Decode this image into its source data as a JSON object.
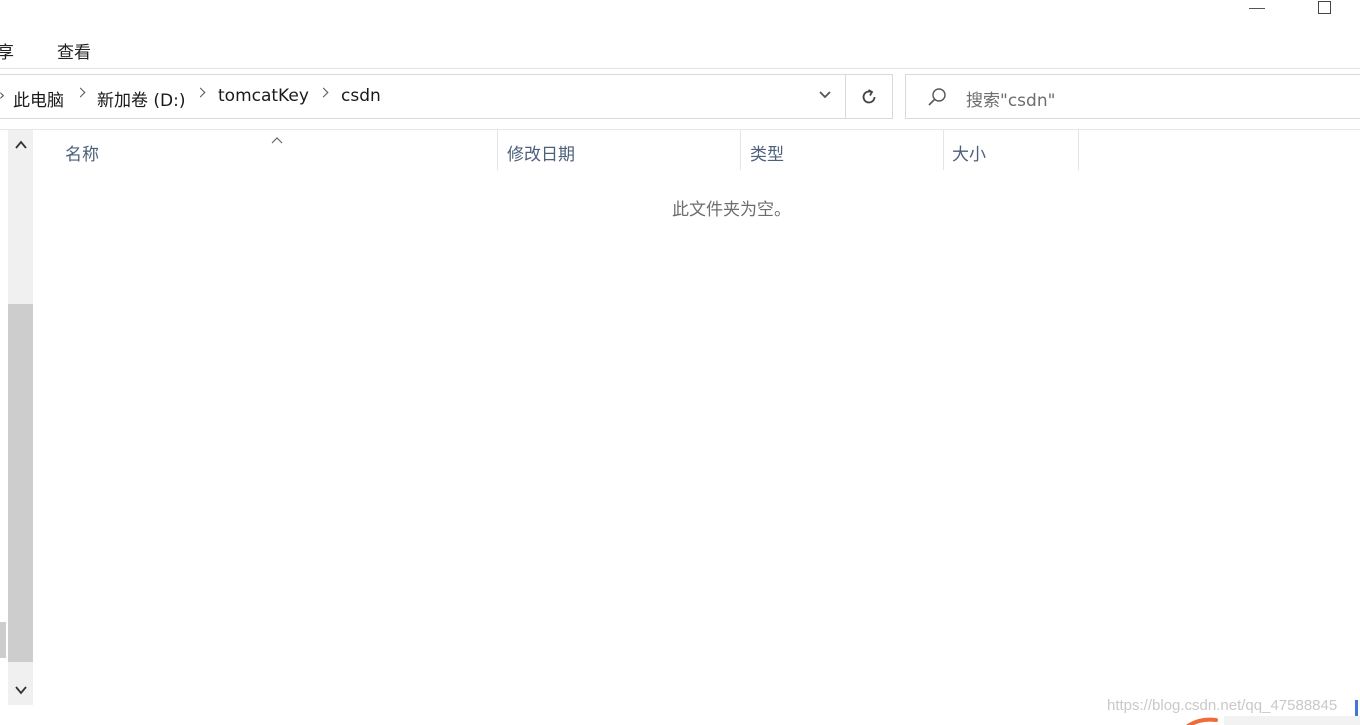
{
  "ribbon": {
    "tabs": [
      {
        "label": "享"
      },
      {
        "label": "查看"
      }
    ]
  },
  "address_bar": {
    "crumbs": [
      "此电脑",
      "新加卷 (D:)",
      "tomcatKey",
      "csdn"
    ]
  },
  "search": {
    "placeholder": "搜索\"csdn\""
  },
  "columns": [
    {
      "label": "名称"
    },
    {
      "label": "修改日期"
    },
    {
      "label": "类型"
    },
    {
      "label": "大小"
    }
  ],
  "file_list": {
    "empty_message": "此文件夹为空。"
  },
  "watermark": "https://blog.csdn.net/qq_47588845",
  "colors": {
    "header_text": "#4c607a",
    "border": "#d9d9d9",
    "scroll_thumb": "#cdcdcd",
    "watermark": "#c9c9c9",
    "accent_blue": "#3a7bd5",
    "mark_orange": "#f06a3a"
  }
}
